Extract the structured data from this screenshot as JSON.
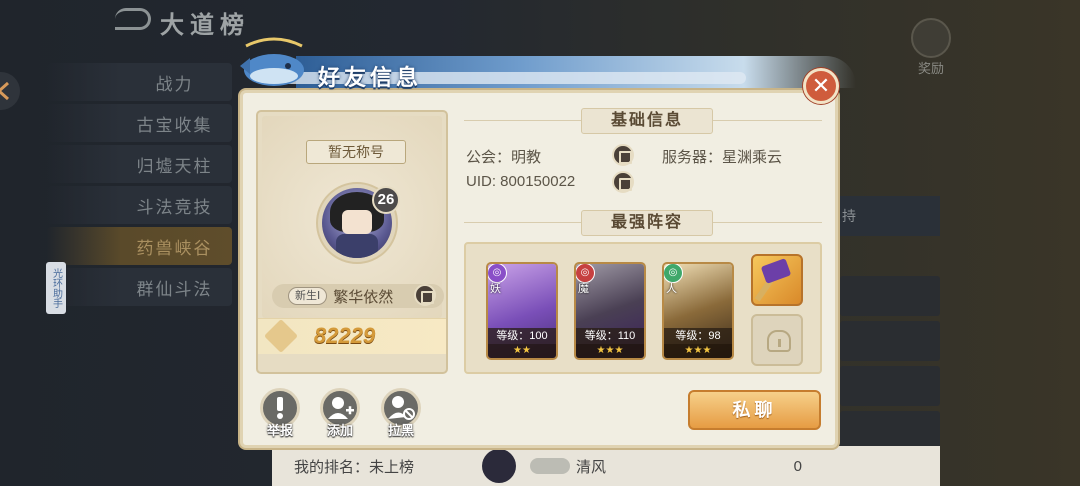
{
  "background": {
    "title": "大道榜",
    "reward_label": "奖励",
    "side_tabs": [
      "战力",
      "古宝收集",
      "归墟天柱",
      "斗法竞技",
      "药兽峡谷",
      "群仙斗法"
    ],
    "active_tab_index": 4,
    "side_badge": "光环助手",
    "right_top_label": "持",
    "bottom": {
      "my_rank_label": "我的排名：",
      "my_rank_value": "未上榜",
      "player_name": "清风",
      "score": "0"
    }
  },
  "dialog": {
    "title": "好友信息",
    "close_symbol": "✕",
    "profile": {
      "title_badge": "暂无称号",
      "level": "26",
      "newbie_tag": "新生Ⅰ",
      "player_name": "繁华依然",
      "power": "82229"
    },
    "basic_info": {
      "section_title": "基础信息",
      "guild_label": "公会：明教",
      "server_label": "服务器：星渊乘云",
      "uid_label": "UID: 800150022"
    },
    "lineup": {
      "section_title": "最强阵容",
      "heroes": [
        {
          "race": "妖",
          "level": "等级：100",
          "stars": "★★",
          "color": "#8a4fc8"
        },
        {
          "race": "魔",
          "level": "等级：110",
          "stars": "★★★",
          "color": "#c64040"
        },
        {
          "race": "人",
          "level": "等级：98",
          "stars": "★★★",
          "color": "#3fa86a"
        }
      ]
    },
    "actions": {
      "report": "举报",
      "add": "添加",
      "block": "拉黑",
      "private_chat": "私聊"
    }
  }
}
